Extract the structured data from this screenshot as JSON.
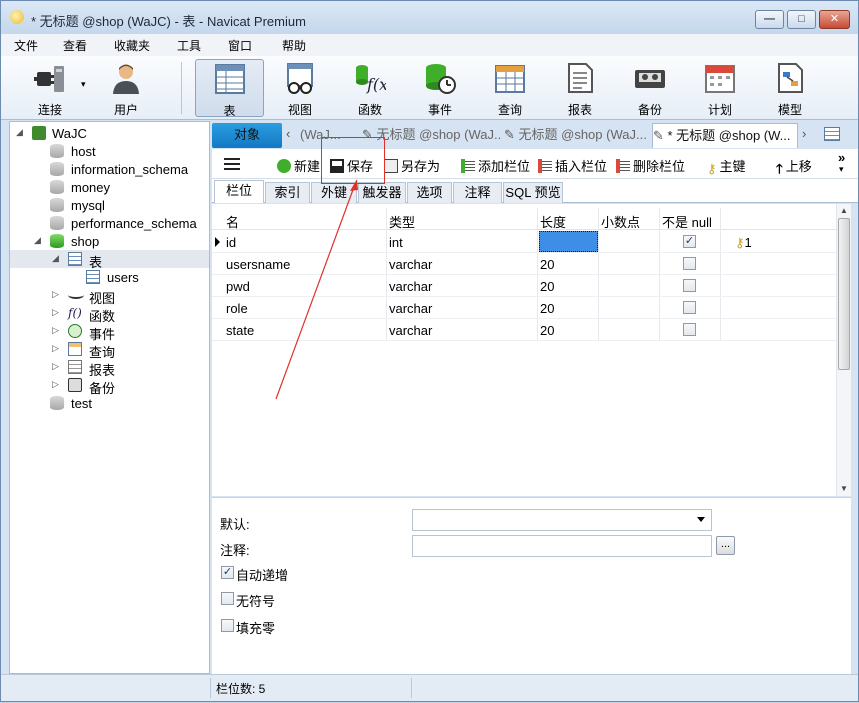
{
  "window": {
    "title": "* 无标题 @shop (WaJC) - 表 - Navicat Premium",
    "controls": {
      "minimize": "—",
      "maximize": "□",
      "close": "✕"
    }
  },
  "menu": [
    "文件",
    "查看",
    "收藏夹",
    "工具",
    "窗口",
    "帮助"
  ],
  "toolbar": [
    {
      "label": "连接",
      "icon": "plug-icon",
      "dropdown_glyph": "▾"
    },
    {
      "label": "用户",
      "icon": "user-icon"
    },
    {
      "label": "表",
      "icon": "table-icon",
      "active": true
    },
    {
      "label": "视图",
      "icon": "view-glasses-icon"
    },
    {
      "label": "函数",
      "icon": "function-icon"
    },
    {
      "label": "事件",
      "icon": "event-clock-icon"
    },
    {
      "label": "查询",
      "icon": "query-icon"
    },
    {
      "label": "报表",
      "icon": "report-icon"
    },
    {
      "label": "备份",
      "icon": "backup-tape-icon"
    },
    {
      "label": "计划",
      "icon": "calendar-icon"
    },
    {
      "label": "模型",
      "icon": "model-icon"
    }
  ],
  "tree": {
    "connection": "WaJC",
    "databases": [
      "host",
      "information_schema",
      "money",
      "mysql",
      "performance_schema",
      "shop",
      "test"
    ],
    "shop_children": [
      "表",
      "视图",
      "函数",
      "事件",
      "查询",
      "报表",
      "备份"
    ],
    "table_items": [
      "users"
    ],
    "expand_open": "◢",
    "expand_closed": "▷",
    "function_glyph": "f()"
  },
  "object_tabs": {
    "objects_tab": "对象",
    "tabs": [
      "(WaJ...",
      "无标题 @shop (WaJ...",
      "无标题 @shop (WaJ...",
      "* 无标题 @shop (W..."
    ],
    "nav_prev": "‹",
    "nav_next": "›"
  },
  "designer_toolbar": {
    "new": "新建",
    "save": "保存",
    "save_as": "另存为",
    "add_field": "添加栏位",
    "insert_field": "插入栏位",
    "delete_field": "删除栏位",
    "primary_key": "主键",
    "move_up": "上移",
    "more_glyph": "»",
    "up_glyph": "🡑",
    "key_glyph": "⚷",
    "dropdown_glyph": "▾"
  },
  "inner_tabs": [
    "栏位",
    "索引",
    "外键",
    "触发器",
    "选项",
    "注释",
    "SQL 预览"
  ],
  "fields_grid": {
    "columns": [
      "名",
      "类型",
      "长度",
      "小数点",
      "不是 null"
    ],
    "rows": [
      {
        "name": "id",
        "type": "int",
        "length": "",
        "decimals": "",
        "not_null": true,
        "key": "1"
      },
      {
        "name": "usersname",
        "type": "varchar",
        "length": "20",
        "decimals": "",
        "not_null": false,
        "key": ""
      },
      {
        "name": "pwd",
        "type": "varchar",
        "length": "20",
        "decimals": "",
        "not_null": false,
        "key": ""
      },
      {
        "name": "role",
        "type": "varchar",
        "length": "20",
        "decimals": "",
        "not_null": false,
        "key": ""
      },
      {
        "name": "state",
        "type": "varchar",
        "length": "20",
        "decimals": "",
        "not_null": false,
        "key": ""
      }
    ],
    "check_glyph": "✓",
    "key_glyph": "⚷"
  },
  "properties": {
    "default_label": "默认:",
    "default_value": "",
    "comment_label": "注释:",
    "comment_value": "",
    "ellipsis": "...",
    "auto_increment": {
      "label": "自动递增",
      "checked": true
    },
    "unsigned": {
      "label": "无符号",
      "checked": false
    },
    "zerofill": {
      "label": "填充零",
      "checked": false
    }
  },
  "status": {
    "field_count": "栏位数: 5"
  },
  "scroll": {
    "up": "▲",
    "down": "▼"
  },
  "colors": {
    "accent": "#1a8ad8",
    "annotation": "#e0302a"
  }
}
